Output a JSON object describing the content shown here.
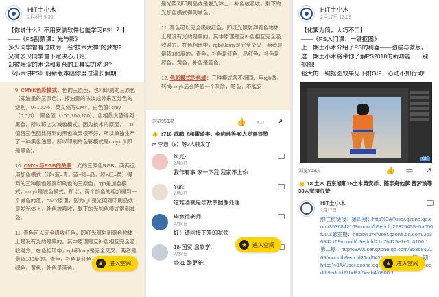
{
  "panel1": {
    "author": "HIT土小木",
    "time": "2月8日 9:30",
    "body_lines": [
      "【你说什么？不用安装软件也能学习PS！？】",
      "——《PS副蒙课：光与影》",
      "多少同学曾有过成为一名“技术大神”的梦想?",
      "又有多少同学曾下定决心开始,",
      "却被晦涩的术语和复杂的工具实力劝退?",
      "《小木讲PS》船新版本陪你度过漫长假期!"
    ],
    "article_p9_num": "9.",
    "article_p9_title": "CMYK色彩模式",
    "article_p9_text": "，色的三原色，也叫印刷的三原色（即油墨的三原色），按油墨的浓淡成分来区分色的级别，0~100%，英文缩写CMY。白色值: cmy（0,0,0）; 黑色值（100,100,100）。色相最大值得到黑色，所以称之为减色模式。因为技术的原因，100值得三色配比得到的黑色效果很不好，所以单独生产了一种黑色油墨，所以印刷的色彩模式是cmyk (k即是黑色)。",
    "article_p10_num": "10.",
    "article_p10_title": "CMYK与RGB的关系",
    "article_p10_text": "：光的三原色RGB，两两运用加色模式（绿+蓝=青，蓝+红=品，绿+红=黄）得到的三种颜色是真印刷色的三原色，rgb是加色模式，cmyk是减色模式。所以，两个加色的相加得到一个减色的值，CMY原理，因为rgb是光照到印刷品或是发光体上，补色被吸收，剩下的光加色模式得到减色。",
    "article_p11_num": "11.",
    "article_p11_text": "青色可以完全吸收红色，即红光照射到青色物体上是没有光的是黑的。其中原理是互补色相互完全吸收对方。在色相环中，rgb和cmy是完全交叉，两者是最转180度的，青色，补色是红色，品红色，补色是绿色，黄色，补色是蓝色。",
    "enter_label": "进入空间"
  },
  "panel2": {
    "article_top_text": "是光照到印刷品或是发光体上，补色被吸收，剩下的光加色模式得到减色。",
    "article_p11_num": "11.",
    "article_p11_text": "青色可以完全吸收红色，即红光照射到青色物体上是没有光的是黑的。其中原理是互补色相互完全吸收对方。在色相环中，rgb和cmy是完全交叉，两者是最转180度的，青色，补色是红色，品红色，补色是绿色，黄色，补色是蓝色。",
    "article_p12_num": "12.",
    "article_p12_title": "色彩模式的色域",
    "article_p12_text": "：三种模式各不相同，用rgb做，转成cmyk后会降低一个灰阶，暗色，不能安",
    "views": "浏览959次",
    "likes_text": "b716·武鹏飞和霍琦丰、李向玮等40人觉得很赞",
    "forward_text": "李通（8）等3人转发了",
    "comments": [
      {
        "name": "风光·",
        "time": "2月8日",
        "text": "我作有事 家一下我 我家不上你"
      },
      {
        "name": "Yun:",
        "time": "2月8日",
        "text": "这难酒就是😊数字图像处理"
      },
      {
        "name": "毕竟徐老师:",
        "time": "2月8日",
        "text": "好！请问接下来的呢😊"
      },
      {
        "name": "18-国贸 温软学:",
        "time": "2月8日",
        "text": "😊x1 蹲更新!"
      }
    ],
    "enter_label": "进入空间"
  },
  "panel3": {
    "author": "HIT土小木",
    "time": "2月17日 13:09",
    "body_lines": [
      "【化繁为简，大巧不工】",
      "——《PS入门课：一键抠图》",
      "上一期土小木介绍了PS的利器——图层与蒙版，",
      "这一期土小木将带你了解PS2018的新功能：一键抠图!",
      "强大的一键抠图效果见下附GIF，心动不如行动!"
    ],
    "gif_tag": "GIF",
    "views": "浏览863次",
    "likes_text": "18 土木 石东旭和16土木黄安栎、陈宇舟他爹 曾梦瑜等38人觉得很赞",
    "comment_name": "HIT土小木",
    "comment_time": "2月17日",
    "comment_lines": [
      "附往前链接：第四期：http%3A//user.qzone.qq.com/3536842169/mood/b9edcfd22325455e0a050f00.1第三期：https%3A//user.qzone.qq.com/3536842169/mood/b9edcfd21c7b425e1e1d0100.1第二期：http%3A//user.qzone.qq.com/3536842169/mood/b9edcfd21cd6425eab4f0800.1第一期：https%3A//user.qzone.qq.com/3536842169/mood/b9edcfd21bd83f5eab4f0800.1"
    ],
    "enter_label": "进入空间"
  }
}
